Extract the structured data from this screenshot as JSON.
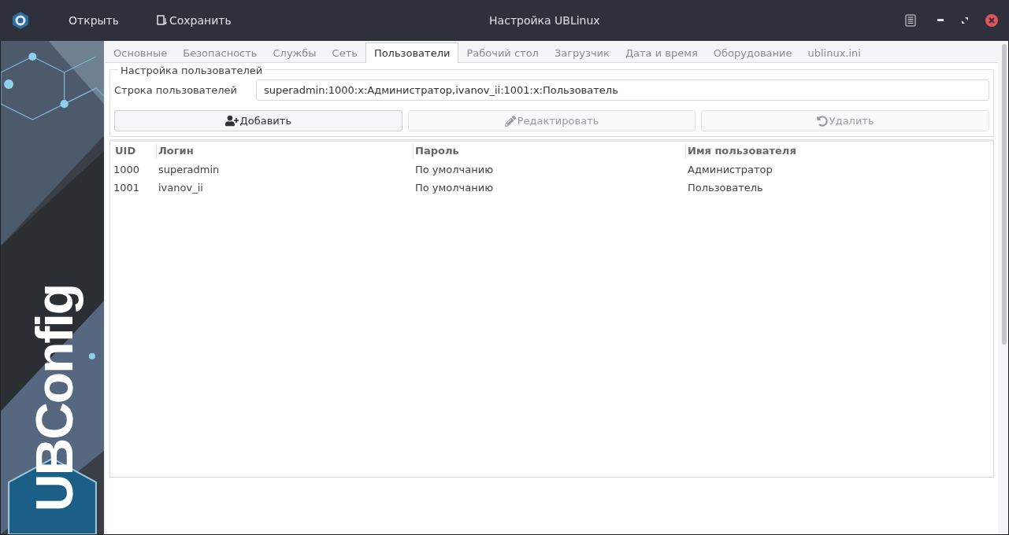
{
  "window": {
    "title": "Настройка UBLinux"
  },
  "toolbar": [
    {
      "kind": "open",
      "label": "Открыть"
    },
    {
      "kind": "save",
      "label": "Сохранить"
    }
  ],
  "sidebar": {
    "logo": "UBConfig"
  },
  "tabs": [
    {
      "label": "Основные",
      "selected": false
    },
    {
      "label": "Безопасность",
      "selected": false
    },
    {
      "label": "Службы",
      "selected": false
    },
    {
      "label": "Сеть",
      "selected": false
    },
    {
      "label": "Пользователи",
      "selected": true
    },
    {
      "label": "Рабочий стол",
      "selected": false
    },
    {
      "label": "Загрузчик",
      "selected": false
    },
    {
      "label": "Дата и время",
      "selected": false
    },
    {
      "label": "Оборудование",
      "selected": false
    },
    {
      "label": "ublinux.ini",
      "selected": false
    }
  ],
  "group": {
    "title": "Настройка пользователей",
    "field_label": "Строка пользователей",
    "field_value": "superadmin:1000:x:Администратор,ivanov_ii:1001:x:Пользователь"
  },
  "buttons": [
    {
      "kind": "add",
      "label": "Добавить",
      "disabled": false
    },
    {
      "kind": "edit",
      "label": "Редактировать",
      "disabled": true
    },
    {
      "kind": "delete",
      "label": "Удалить",
      "disabled": true
    }
  ],
  "table": {
    "columns": [
      "UID",
      "Логин",
      "Пароль",
      "Имя пользователя"
    ],
    "rows": [
      [
        "1000",
        "superadmin",
        "По умолчанию",
        "Администратор"
      ],
      [
        "1001",
        "ivanov_ii",
        "По умолчанию",
        "Пользователь"
      ]
    ]
  }
}
